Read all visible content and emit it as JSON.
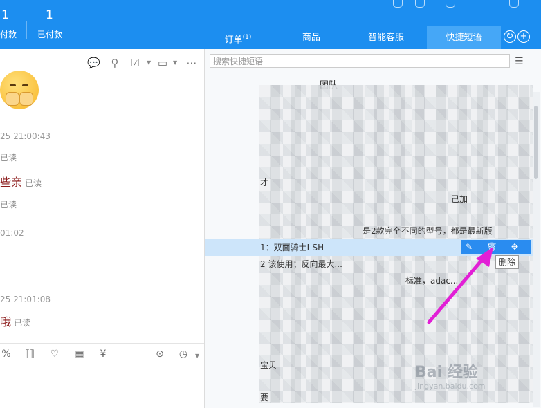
{
  "stats": [
    {
      "value": "1",
      "label": "付款"
    },
    {
      "value": "1",
      "label": "已付款"
    }
  ],
  "tabs": [
    {
      "label": "订单",
      "badge": "(1)"
    },
    {
      "label": "商品",
      "badge": ""
    },
    {
      "label": "智能客服",
      "badge": ""
    },
    {
      "label": "快捷短语",
      "badge": ""
    }
  ],
  "search": {
    "placeholder": "搜索快捷短语"
  },
  "category": {
    "label": "团队"
  },
  "chat": {
    "ts1": "25 21:00:43",
    "read1": "已读",
    "msg1": "些亲",
    "read2": "已读",
    "read3": "已读",
    "ts2": "01:02",
    "ts3": "25 21:01:08",
    "msg2": "哦",
    "read4": "已读"
  },
  "rows": [
    {
      "text": "才"
    },
    {
      "text": "己加"
    },
    {
      "text": "是2款完全不同的型号，都是最新版"
    },
    {
      "text": "1：双面骑士I-SH"
    },
    {
      "text": "2                      该使用；反向最大..."
    },
    {
      "text": "                    标准，adac..."
    },
    {
      "text": "宝贝"
    },
    {
      "text": "要"
    }
  ],
  "actions": {
    "tooltip": "删除"
  },
  "watermark": {
    "brand": "Bai 经验",
    "url": "jingyan.baidu.com"
  },
  "colors": {
    "topbar": "#1c8ef0",
    "active_tab": "#45a7f7",
    "selected_row": "#cde5fa",
    "action_bar": "#2a8cf0",
    "arrow": "#e21fd6"
  }
}
